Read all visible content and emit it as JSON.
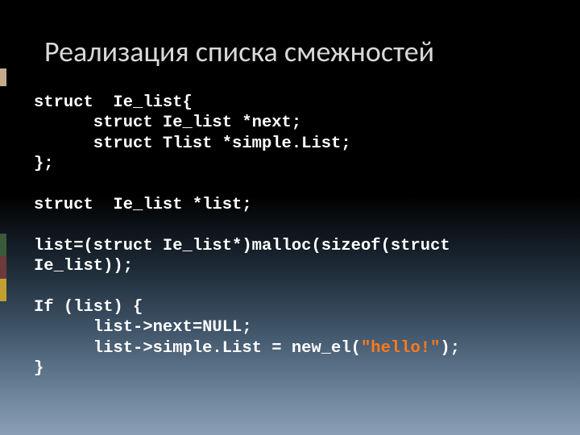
{
  "title": "Реализация списка смежностей",
  "code": {
    "l1": "struct  Ie_list{",
    "l2": "      struct Ie_list *next;",
    "l3": "      struct Tlist *simple.List;",
    "l4": "};",
    "l5": "",
    "l6": "struct  Ie_list *list;",
    "l7": "",
    "l8": "list=(struct Ie_list*)malloc(sizeof(struct",
    "l9": "Ie_list));",
    "l10": "",
    "l11": "If (list) {",
    "l12": "      list->next=NULL;",
    "l13a": "      list->simple.List = new_el(",
    "l13b": "\"hello!\"",
    "l13c": ");",
    "l14": "}"
  }
}
